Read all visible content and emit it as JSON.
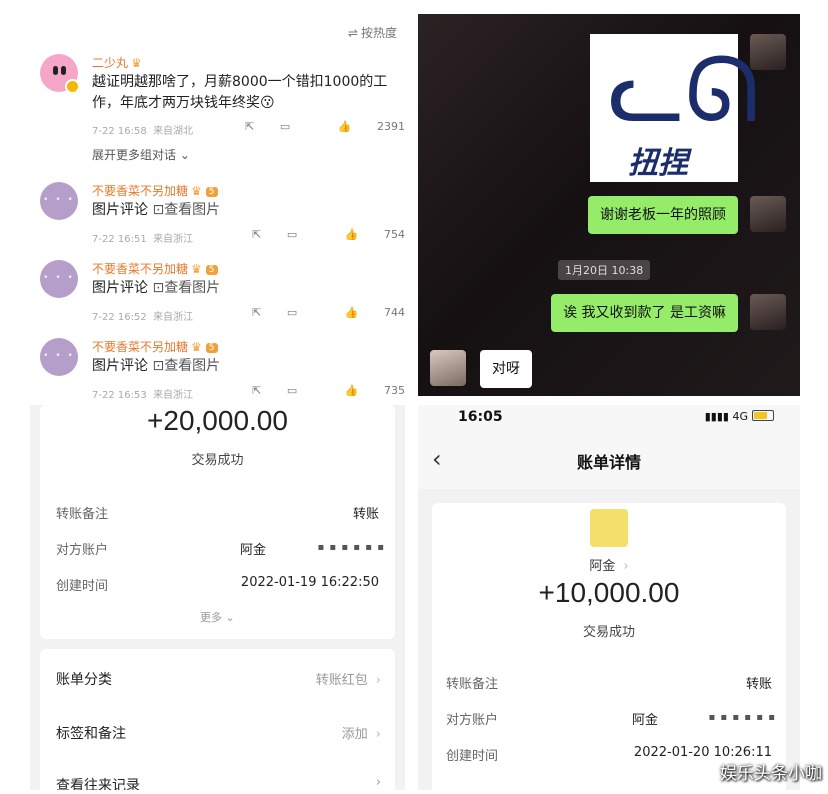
{
  "comments_panel": {
    "sort_label": "按热度",
    "comments": [
      {
        "user": "二少丸",
        "text": "越证明越那啥了，月薪8000一个错扣1000的工作，年底才两万块钱年终奖😗",
        "time": "7-22 16:58",
        "location": "来自湖北",
        "likes": "2391",
        "expand": "展开更多组对话 ⌄"
      },
      {
        "user": "不要香菜不另加糖",
        "badge": "5",
        "text": "图片评论",
        "view_image": "查看图片",
        "time": "7-22 16:51",
        "location": "来自浙江",
        "likes": "754"
      },
      {
        "user": "不要香菜不另加糖",
        "badge": "5",
        "text": "图片评论",
        "view_image": "查看图片",
        "time": "7-22 16:52",
        "location": "来自浙江",
        "likes": "744"
      },
      {
        "user": "不要香菜不另加糖",
        "badge": "5",
        "text": "图片评论",
        "view_image": "查看图片",
        "time": "7-22 16:53",
        "location": "来自浙江",
        "likes": "735"
      }
    ]
  },
  "chat_panel": {
    "sticker_text": "扭捏",
    "message_thanks": "谢谢老板一年的照顾",
    "timestamp": "1月20日 10:38",
    "message_salary": "诶 我又收到款了 是工资嘛",
    "reply": "对呀"
  },
  "receipt_left": {
    "amount": "+20,000.00",
    "status": "交易成功",
    "note_label": "转账备注",
    "note_value": "转账",
    "account_label": "对方账户",
    "account_name": "阿金",
    "account_masked": "▪ ▪ ▪ ▪ ▪ ▪",
    "created_label": "创建时间",
    "created_value": "2022-01-19 16:22:50",
    "more": "更多",
    "category_label": "账单分类",
    "category_value": "转账红包",
    "tags_label": "标签和备注",
    "tags_value": "添加",
    "history_label": "查看往来记录"
  },
  "receipt_right": {
    "clock": "16:05",
    "network": "4G",
    "nav_title": "账单详情",
    "payee": "阿金",
    "amount": "+10,000.00",
    "status": "交易成功",
    "note_label": "转账备注",
    "note_value": "转账",
    "account_label": "对方账户",
    "account_name": "阿金",
    "account_masked": "▪ ▪ ▪ ▪ ▪ ▪",
    "created_label": "创建时间",
    "created_value": "2022-01-20 10:26:11"
  },
  "watermark": "娱乐头条小咖",
  "colors": {
    "chat_green": "#95ec69",
    "username_orange": "#e8782a"
  }
}
